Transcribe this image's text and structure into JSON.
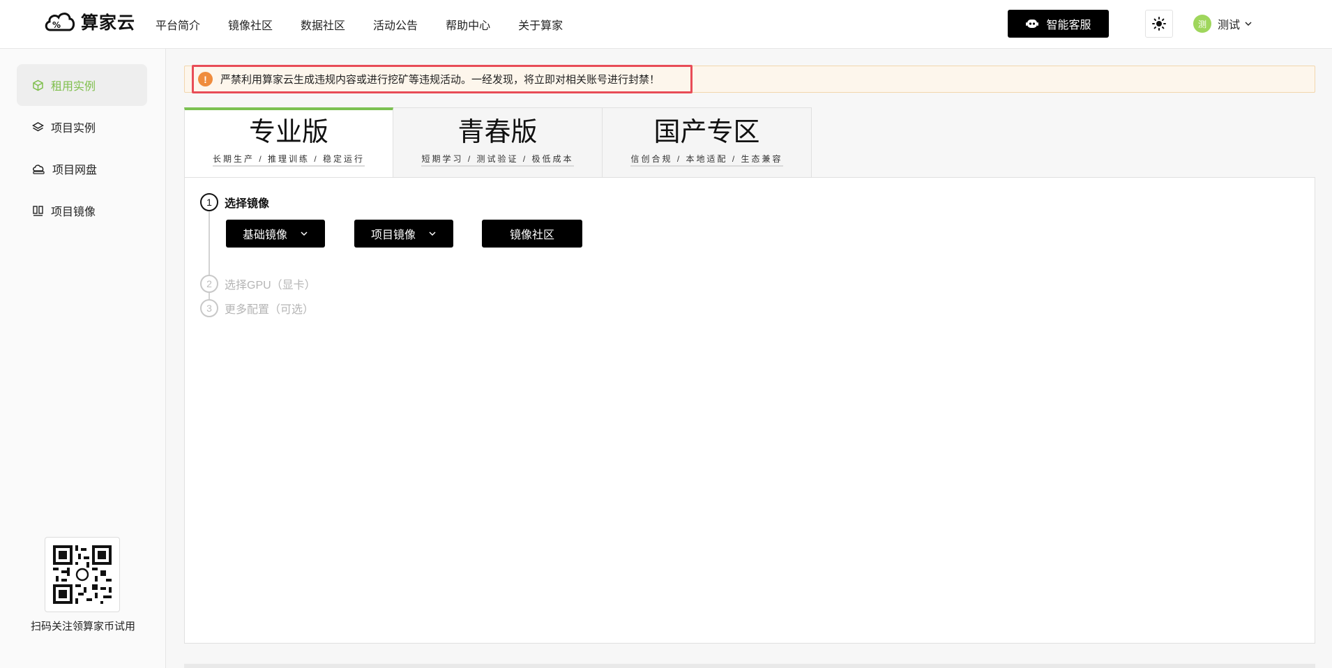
{
  "header": {
    "logo_text": "算家云",
    "nav": [
      "平台简介",
      "镜像社区",
      "数据社区",
      "活动公告",
      "帮助中心",
      "关于算家"
    ],
    "customer_service_label": "智能客服",
    "theme_icon": "sun-icon",
    "user": {
      "avatar_text": "测",
      "name": "测试"
    }
  },
  "sidebar": {
    "items": [
      {
        "label": "租用实例",
        "icon": "cube-icon",
        "active": true
      },
      {
        "label": "项目实例",
        "icon": "layers-icon",
        "active": false
      },
      {
        "label": "项目网盘",
        "icon": "cloud-disk-icon",
        "active": false
      },
      {
        "label": "项目镜像",
        "icon": "image-stack-icon",
        "active": false
      }
    ],
    "qr_caption": "扫码关注领算家币试用"
  },
  "notice": {
    "icon": "warning-icon",
    "text": "严禁利用算家云生成违规内容或进行挖矿等违规活动。一经发现，将立即对相关账号进行封禁！"
  },
  "tabs": [
    {
      "title": "专业版",
      "subtitle": "长期生产 / 推理训练 / 稳定运行",
      "active": true
    },
    {
      "title": "青春版",
      "subtitle": "短期学习 / 测试验证 / 极低成本",
      "active": false
    },
    {
      "title": "国产专区",
      "subtitle": "信创合规 / 本地适配 / 生态兼容",
      "active": false
    }
  ],
  "steps": [
    {
      "number": "1",
      "label": "选择镜像",
      "active": true
    },
    {
      "number": "2",
      "label": "选择GPU（显卡）",
      "active": false
    },
    {
      "number": "3",
      "label": "更多配置（可选）",
      "active": false
    }
  ],
  "image_buttons": {
    "base_image": "基础镜像",
    "project_image": "项目镜像",
    "community": "镜像社区"
  },
  "colors": {
    "accent_green": "#7cc152",
    "highlight_red": "#e84c57",
    "warning_orange": "#ef8c3d"
  }
}
